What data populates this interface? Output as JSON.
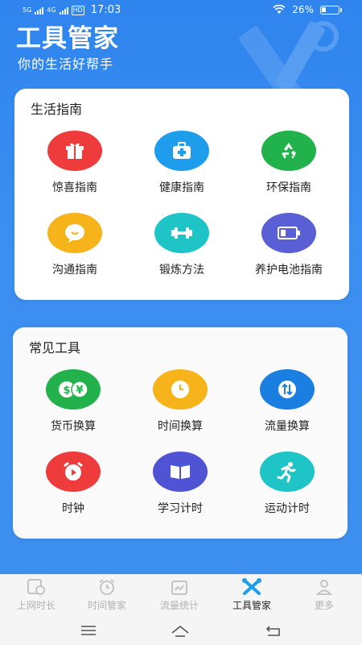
{
  "status_bar": {
    "network_labels": [
      "5G",
      "4G"
    ],
    "hd_label": "HD",
    "time": "17:03",
    "battery_text": "26%",
    "battery_level": 0.26
  },
  "header": {
    "title": "工具管家",
    "subtitle": "你的生活好帮手"
  },
  "life_guide": {
    "title": "生活指南",
    "items": [
      {
        "label": "惊喜指南",
        "icon": "gift-icon",
        "color": "#ee3b3b"
      },
      {
        "label": "健康指南",
        "icon": "medical-kit-icon",
        "color": "#1f9ded"
      },
      {
        "label": "环保指南",
        "icon": "recycle-icon",
        "color": "#22b24c"
      },
      {
        "label": "沟通指南",
        "icon": "chat-bubble-icon",
        "color": "#f6b31a"
      },
      {
        "label": "锻炼方法",
        "icon": "dumbbell-icon",
        "color": "#1fc5c6"
      },
      {
        "label": "养护电池指南",
        "icon": "battery-icon",
        "color": "#5b5fd6"
      }
    ]
  },
  "common_tools": {
    "title": "常见工具",
    "items": [
      {
        "label": "货币换算",
        "icon": "currency-exchange-icon",
        "color": "#23b14b"
      },
      {
        "label": "时间换算",
        "icon": "clock-icon",
        "color": "#f6b31a"
      },
      {
        "label": "流量换算",
        "icon": "data-transfer-icon",
        "color": "#1a7fe0"
      },
      {
        "label": "时钟",
        "icon": "alarm-clock-icon",
        "color": "#ee3b3b"
      },
      {
        "label": "学习计时",
        "icon": "book-icon",
        "color": "#5054d4"
      },
      {
        "label": "运动计时",
        "icon": "running-icon",
        "color": "#1fc5c6"
      }
    ]
  },
  "tab_bar": {
    "tabs": [
      {
        "label": "上网时长",
        "icon": "calendar-clock-icon",
        "active": false
      },
      {
        "label": "时间管家",
        "icon": "alarm-icon",
        "active": false
      },
      {
        "label": "流量统计",
        "icon": "data-stats-icon",
        "active": false
      },
      {
        "label": "工具管家",
        "icon": "tools-icon",
        "active": true
      },
      {
        "label": "更多",
        "icon": "user-icon",
        "active": false
      }
    ]
  },
  "nav_bar": {
    "buttons": [
      "menu-icon",
      "home-icon",
      "back-icon"
    ]
  },
  "colors": {
    "primary_blue": "#3a8ff0",
    "active_tab": "#1f9ded",
    "inactive_tab": "#b3b3b3"
  }
}
